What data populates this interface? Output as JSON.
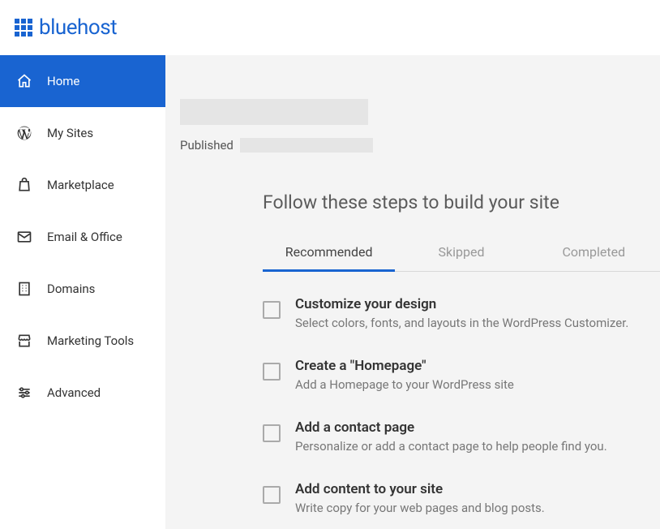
{
  "brand": "bluehost",
  "sidebar": {
    "items": [
      {
        "label": "Home",
        "icon": "home"
      },
      {
        "label": "My Sites",
        "icon": "wordpress"
      },
      {
        "label": "Marketplace",
        "icon": "bag"
      },
      {
        "label": "Email & Office",
        "icon": "mail"
      },
      {
        "label": "Domains",
        "icon": "building"
      },
      {
        "label": "Marketing Tools",
        "icon": "storefront"
      },
      {
        "label": "Advanced",
        "icon": "sliders"
      }
    ]
  },
  "site_info": {
    "published_label": "Published"
  },
  "steps": {
    "title": "Follow these steps to build your site",
    "tabs": [
      {
        "label": "Recommended",
        "active": true
      },
      {
        "label": "Skipped",
        "active": false
      },
      {
        "label": "Completed",
        "active": false
      }
    ],
    "items": [
      {
        "title": "Customize your design",
        "desc": "Select colors, fonts, and layouts in the WordPress Customizer."
      },
      {
        "title": "Create a \"Homepage\"",
        "desc": "Add a Homepage to your WordPress site"
      },
      {
        "title": "Add a contact page",
        "desc": "Personalize or add a contact page to help people find you."
      },
      {
        "title": "Add content to your site",
        "desc": "Write copy for your web pages and blog posts."
      }
    ]
  }
}
